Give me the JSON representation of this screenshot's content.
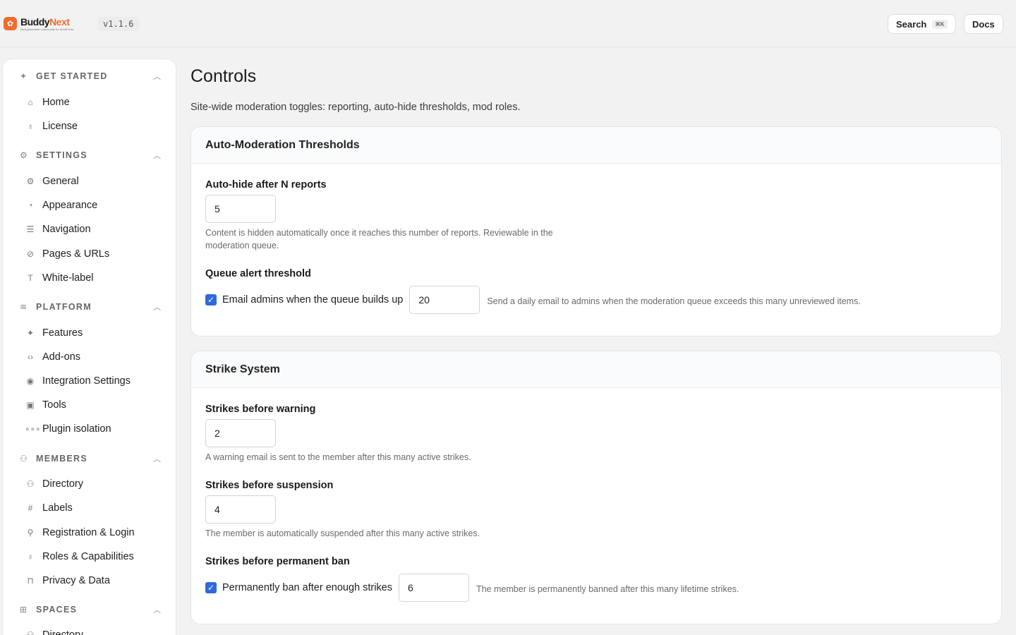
{
  "app": {
    "logo_mark": "✿",
    "logo_name_a": "Buddy",
    "logo_name_b": "Next",
    "logo_tagline": "Next-generation community for WordPress",
    "version": "v1.1.6"
  },
  "header": {
    "search_label": "Search",
    "search_shortcut": "⌘K",
    "docs_label": "Docs"
  },
  "sidebar": {
    "groups": [
      {
        "label": "GET STARTED",
        "icon": "sparkles-icon",
        "items": [
          {
            "label": "Home",
            "icon": "home-icon"
          },
          {
            "label": "License",
            "icon": "award-icon"
          }
        ]
      },
      {
        "label": "SETTINGS",
        "icon": "gear-icon",
        "items": [
          {
            "label": "General",
            "icon": "gear-icon"
          },
          {
            "label": "Appearance",
            "icon": "palette-icon"
          },
          {
            "label": "Navigation",
            "icon": "list-icon"
          },
          {
            "label": "Pages & URLs",
            "icon": "link-icon"
          },
          {
            "label": "White-label",
            "icon": "type-icon"
          }
        ]
      },
      {
        "label": "PLATFORM",
        "icon": "layers-icon",
        "items": [
          {
            "label": "Features",
            "icon": "sparkles-icon"
          },
          {
            "label": "Add-ons",
            "icon": "code-icon"
          },
          {
            "label": "Integration Settings",
            "icon": "eye-icon"
          },
          {
            "label": "Tools",
            "icon": "cpu-icon"
          },
          {
            "label": "Plugin isolation",
            "icon": "dots-icon"
          }
        ]
      },
      {
        "label": "MEMBERS",
        "icon": "users-icon",
        "items": [
          {
            "label": "Directory",
            "icon": "users-icon"
          },
          {
            "label": "Labels",
            "icon": "hash-icon"
          },
          {
            "label": "Registration & Login",
            "icon": "user-icon"
          },
          {
            "label": "Roles & Capabilities",
            "icon": "award-icon"
          },
          {
            "label": "Privacy & Data",
            "icon": "lock-icon"
          }
        ]
      },
      {
        "label": "SPACES",
        "icon": "grid-icon",
        "items": [
          {
            "label": "Directory",
            "icon": "users-icon"
          }
        ]
      }
    ]
  },
  "main": {
    "title": "Controls",
    "subtitle": "Site-wide moderation toggles: reporting, auto-hide thresholds, mod roles.",
    "auto_mod": {
      "title": "Auto-Moderation Thresholds",
      "autohide_label": "Auto-hide after N reports",
      "autohide_value": "5",
      "autohide_help": "Content is hidden automatically once it reaches this number of reports. Reviewable in the moderation queue.",
      "queue_label": "Queue alert threshold",
      "queue_checkbox_label": "Email admins when the queue builds up",
      "queue_checked": true,
      "queue_value": "20",
      "queue_help": "Send a daily email to admins when the moderation queue exceeds this many unreviewed items."
    },
    "strike": {
      "title": "Strike System",
      "warning_label": "Strikes before warning",
      "warning_value": "2",
      "warning_help": "A warning email is sent to the member after this many active strikes.",
      "suspension_label": "Strikes before suspension",
      "suspension_value": "4",
      "suspension_help": "The member is automatically suspended after this many active strikes.",
      "ban_label": "Strikes before permanent ban",
      "ban_checkbox_label": "Permanently ban after enough strikes",
      "ban_checked": true,
      "ban_value": "6",
      "ban_help": "The member is permanently banned after this many lifetime strikes."
    }
  },
  "colors": {
    "brand": "#f26b2e",
    "checkbox": "#2e69dd",
    "page_bg": "#f2f2f2"
  }
}
